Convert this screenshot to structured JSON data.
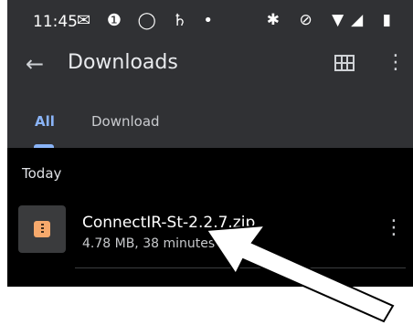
{
  "status_bar": {
    "time": "11:45",
    "left_icons": "✉ ❶ ◯ ♄ •",
    "right_icons": "✱ ⊘ ▼◢ ▮"
  },
  "app_bar": {
    "back_icon": "arrow-left-icon",
    "back_glyph": "←",
    "title": "Downloads",
    "grid_icon": "grid-view-icon",
    "menu_glyph": "⋮"
  },
  "tabs": [
    {
      "label": "All",
      "selected": true
    },
    {
      "label": "Download",
      "selected": false
    }
  ],
  "section_header": "Today",
  "files": [
    {
      "name": "ConnectIR-St-2.2.7.zip",
      "meta": "4.78 MB, 38 minutes ago",
      "icon": "zip-file-icon",
      "more_glyph": "⋮"
    }
  ],
  "colors": {
    "bar_bg": "#303134",
    "accent": "#8ab4f8",
    "zip_icon": "#f6a96c"
  }
}
